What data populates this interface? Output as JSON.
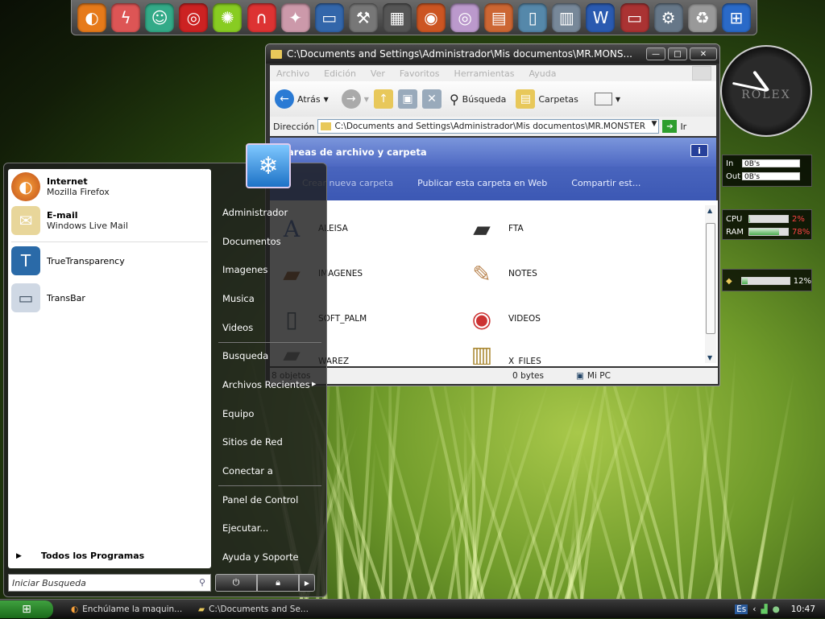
{
  "dock": {
    "icons": [
      "firefox-icon",
      "lightning-icon",
      "messenger-icon",
      "game-icon",
      "lime-icon",
      "magnet-icon",
      "stars-icon",
      "monitor-icon",
      "tools-icon",
      "film-icon",
      "media-icon",
      "disc-icon",
      "archive-icon",
      "phone-icon",
      "files-icon",
      "word-icon",
      "red-monitor-icon",
      "gear-icon",
      "recycle-bin-icon",
      "windows-icon"
    ]
  },
  "explorer": {
    "title": "C:\\Documents and Settings\\Administrador\\Mis documentos\\MR.MONS...",
    "menu": [
      "Archivo",
      "Edición",
      "Ver",
      "Favoritos",
      "Herramientas",
      "Ayuda"
    ],
    "toolbar": {
      "back": "Atrás",
      "search": "Búsqueda",
      "folders": "Carpetas"
    },
    "address_label": "Dirección",
    "address": "C:\\Documents and Settings\\Administrador\\Mis documentos\\MR.MONSTER",
    "go": "Ir",
    "tasks_title": "areas de archivo y carpeta",
    "tasks": [
      "Crear nueva carpeta",
      "Publicar esta carpeta en Web",
      "Compartir est..."
    ],
    "files": [
      "ALEISA",
      "FTA",
      "IMAGENES",
      "NOTES",
      "SOFT_PALM",
      "VIDEOS",
      "WAREZ",
      "X_FILES"
    ],
    "status": {
      "count": "8 objetos",
      "size": "0 bytes",
      "location": "Mi PC"
    }
  },
  "clock": {
    "brand": "ROLEX",
    "hour": 10.78,
    "minute": 47
  },
  "network": {
    "in_label": "In",
    "in_value": "0B's",
    "out_label": "Out",
    "out_value": "0B's"
  },
  "system": {
    "cpu_label": "CPU",
    "cpu_value": "2%",
    "cpu_fraction": 0.02,
    "ram_label": "RAM",
    "ram_value": "78%",
    "ram_fraction": 0.78
  },
  "disk": {
    "value": "12%",
    "fraction": 0.12
  },
  "startmenu": {
    "pinned": [
      {
        "name": "Internet",
        "sub": "Mozilla Firefox"
      },
      {
        "name": "E-mail",
        "sub": "Windows Live Mail"
      }
    ],
    "recent": [
      "TrueTransparency",
      "TransBar"
    ],
    "all_programs": "Todos los Programas",
    "search_placeholder": "Iniciar Busqueda",
    "right": [
      "Administrador",
      "Documentos",
      "Imagenes",
      "Musica",
      "Videos",
      "Busqueda",
      "Archivos Recientes",
      "Equipo",
      "Sitios de Red",
      "Conectar a",
      "Panel de Control",
      "Ejecutar...",
      "Ayuda y Soporte"
    ]
  },
  "taskbar": {
    "tasks": [
      "Enchúlame la maquin...",
      "C:\\Documents and Se..."
    ],
    "lang": "Es",
    "time": "10:47"
  }
}
